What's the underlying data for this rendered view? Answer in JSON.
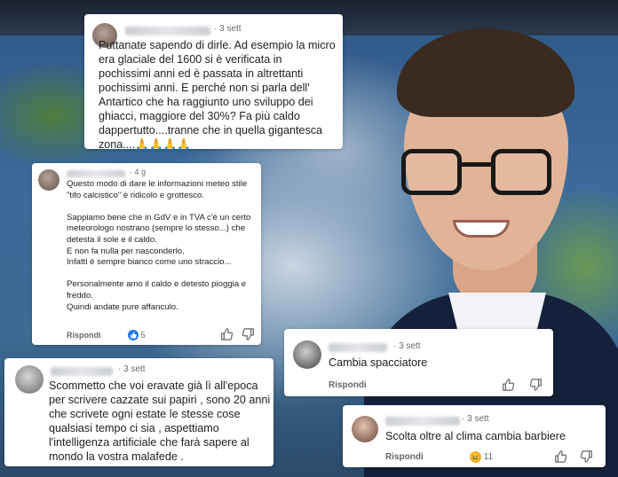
{
  "comments": [
    {
      "id": "c1",
      "time": "· 3 sett",
      "text": "Puttanate sapendo di dirle. Ad esempio la micro era glaciale del 1600 si è verificata in pochissimi anni ed è passata in altrettanti pochissimi anni. E perché non si parla dell' Antartico che ha raggiunto uno sviluppo dei ghiacci, maggiore del 30%? Fa più caldo dappertutto....tranne che in quella gigantesca zona....🙏🙏🙏🙏"
    },
    {
      "id": "c2",
      "time": "· 4 g",
      "text": "Questo modo di dare le informazioni meteo stile \"tifo calcistico\"  è ridicolo e grottesco.\n\nSappiamo bene che in GdV e in TVA c'è un certo meteorologo nostrano (sempre lo stesso...) che detesta il sole e il caldo.\nE non fa nulla per nasconderlo.\nInfatti è sempre bianco come uno straccio...\n\nPersonalmente amo il caldo e detesto pioggia e freddo.\nQuindi andate pure affanculo.",
      "reply_label": "Rispondi",
      "reaction_count": "5",
      "reaction_icon": "thumbs-up-reaction"
    },
    {
      "id": "c3",
      "time": "· 3 sett",
      "text": "Cambia spacciatore",
      "reply_label": "Rispondi"
    },
    {
      "id": "c4",
      "time": "· 3 sett",
      "text": "Scommetto che voi eravate già lì all'epoca per scrivere cazzate sui papiri , sono 20 anni che scrivete ogni estate le stesse cose qualsiasi tempo ci sia , aspettiamo l'intelligenza artificiale che farà sapere al mondo la vostra malafede ."
    },
    {
      "id": "c5",
      "time": "· 3 sett",
      "text": "Scolta oltre al clima cambia barbiere",
      "reply_label": "Rispondi",
      "reaction_count": "11",
      "reaction_icon": "laughing-reaction"
    }
  ],
  "colors": {
    "card_bg": "#ffffff",
    "secondary_text": "#65676b",
    "like_blue": "#1877f2",
    "haha_yellow": "#f7b125"
  }
}
